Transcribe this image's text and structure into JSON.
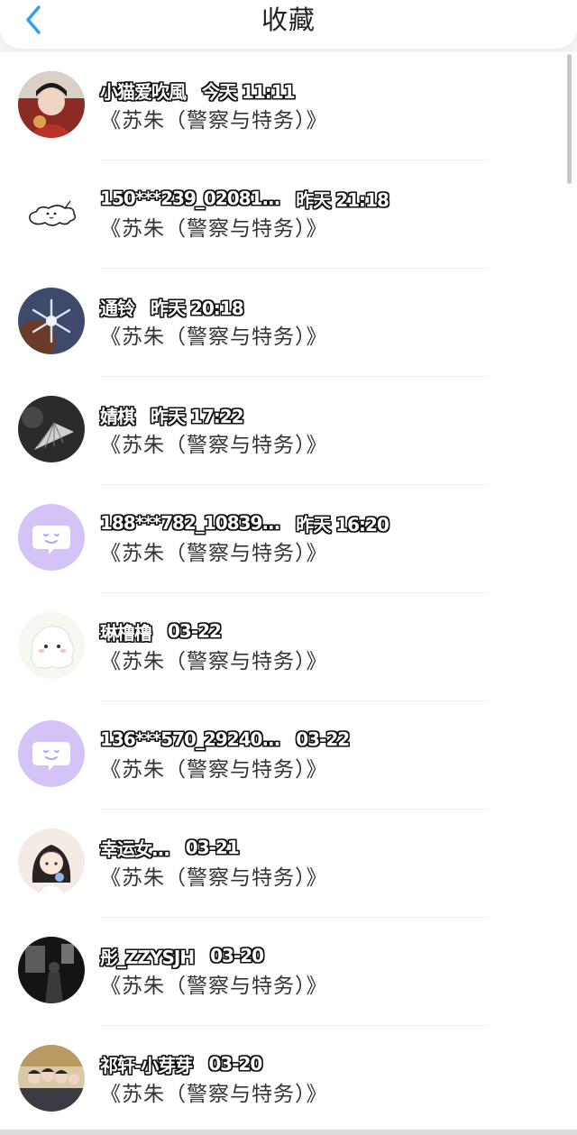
{
  "header": {
    "title": "收藏",
    "back_icon": "chevron-left-icon",
    "accent_color": "#2aa1f2"
  },
  "favorites": [
    {
      "name": "小猫爱吹風",
      "time": "今天 11:11",
      "book": "《苏朱（警察与特务）》",
      "avatar": "portrait-photo"
    },
    {
      "name": "150***239_02081...",
      "time": "昨天 21:18",
      "book": "《苏朱（警察与特务）》",
      "avatar": "cartoon-dog"
    },
    {
      "name": "通铃",
      "time": "昨天 20:18",
      "book": "《苏朱（警察与特务）》",
      "avatar": "snowflake-photo"
    },
    {
      "name": "婧棋",
      "time": "昨天 17:22",
      "book": "《苏朱（警察与特务）》",
      "avatar": "hand-fan-photo"
    },
    {
      "name": "188***782_10839...",
      "time": "昨天 16:20",
      "book": "《苏朱（警察与特务）》",
      "avatar": "default-chat-bubble"
    },
    {
      "name": "琳橹橹",
      "time": "03-22",
      "book": "《苏朱（警察与特务）》",
      "avatar": "cartoon-ghost"
    },
    {
      "name": "136***570_29240...",
      "time": "03-22",
      "book": "《苏朱（警察与特务）》",
      "avatar": "default-chat-bubble"
    },
    {
      "name": "幸运女...",
      "time": "03-21",
      "book": "《苏朱（警察与特务）》",
      "avatar": "anime-girl"
    },
    {
      "name": "彤_ZZYSJH",
      "time": "03-20",
      "book": "《苏朱（警察与特务）》",
      "avatar": "dark-room-photo"
    },
    {
      "name": "祁轩-小芽芽",
      "time": "03-20",
      "book": "《苏朱（警察与特务）》",
      "avatar": "group-photo"
    }
  ]
}
